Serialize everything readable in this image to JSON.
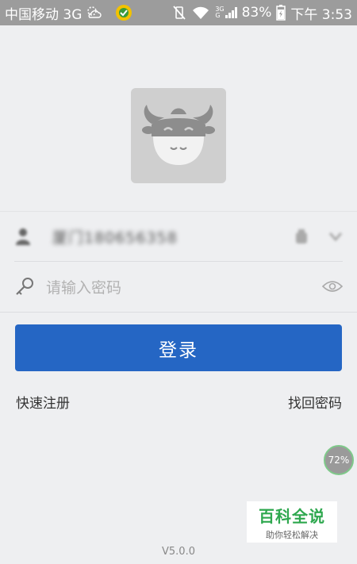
{
  "status_bar": {
    "carrier": "中国移动 3G",
    "net_type_top": "3G",
    "net_type_bottom": "G",
    "battery": "83%",
    "time": "下午 3:53"
  },
  "form": {
    "account_value": "厦门180656358",
    "password_placeholder": "请输入密码"
  },
  "login_button": "登录",
  "links": {
    "register": "快速注册",
    "forgot_password": "找回密码"
  },
  "float_badge": "72%",
  "watermark": {
    "title": "百科全说",
    "subtitle": "助你轻松解决"
  },
  "version": "V5.0.0",
  "colors": {
    "primary": "#2566c4",
    "background": "#eeeff1",
    "status_bar": "#9c9c9c",
    "watermark_green": "#2fa84f"
  }
}
